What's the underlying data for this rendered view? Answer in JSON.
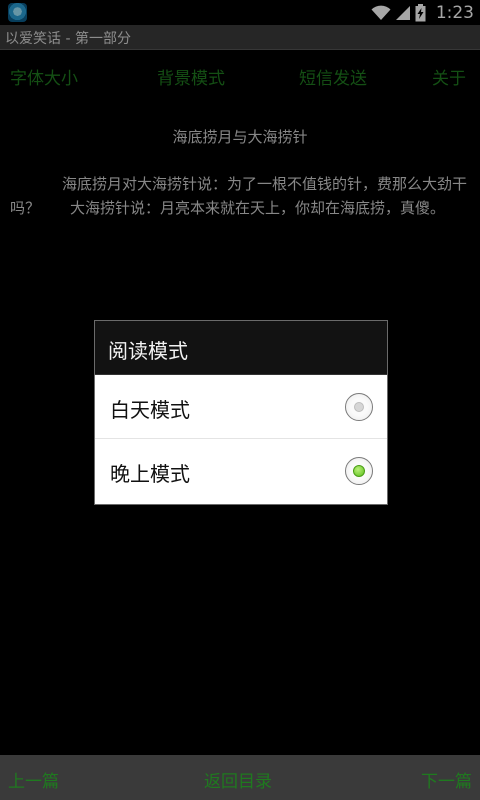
{
  "status_bar": {
    "time": "1:23",
    "icons": [
      "app-icon",
      "wifi-icon",
      "signal-icon",
      "battery-charging-icon"
    ]
  },
  "window": {
    "title": "以爱笑话 - 第一部分"
  },
  "top_menu": {
    "font_size": "字体大小",
    "background_mode": "背景模式",
    "sms_send": "短信发送",
    "about": "关于"
  },
  "article": {
    "title": "海底捞月与大海捞针",
    "body": "海底捞月对大海捞针说：为了一根不值钱的针，费那么大劲干吗？　　大海捞针说：月亮本来就在天上，你却在海底捞，真傻。"
  },
  "dialog": {
    "title": "阅读模式",
    "options": [
      {
        "label": "白天模式",
        "selected": false
      },
      {
        "label": "晚上模式",
        "selected": true
      }
    ]
  },
  "bottom_bar": {
    "prev": "上一篇",
    "back_to_toc": "返回目录",
    "next": "下一篇"
  },
  "colors": {
    "menu_text": "#1f7a1f",
    "radio_selected": "#5cbf1a",
    "background": "#000000"
  }
}
